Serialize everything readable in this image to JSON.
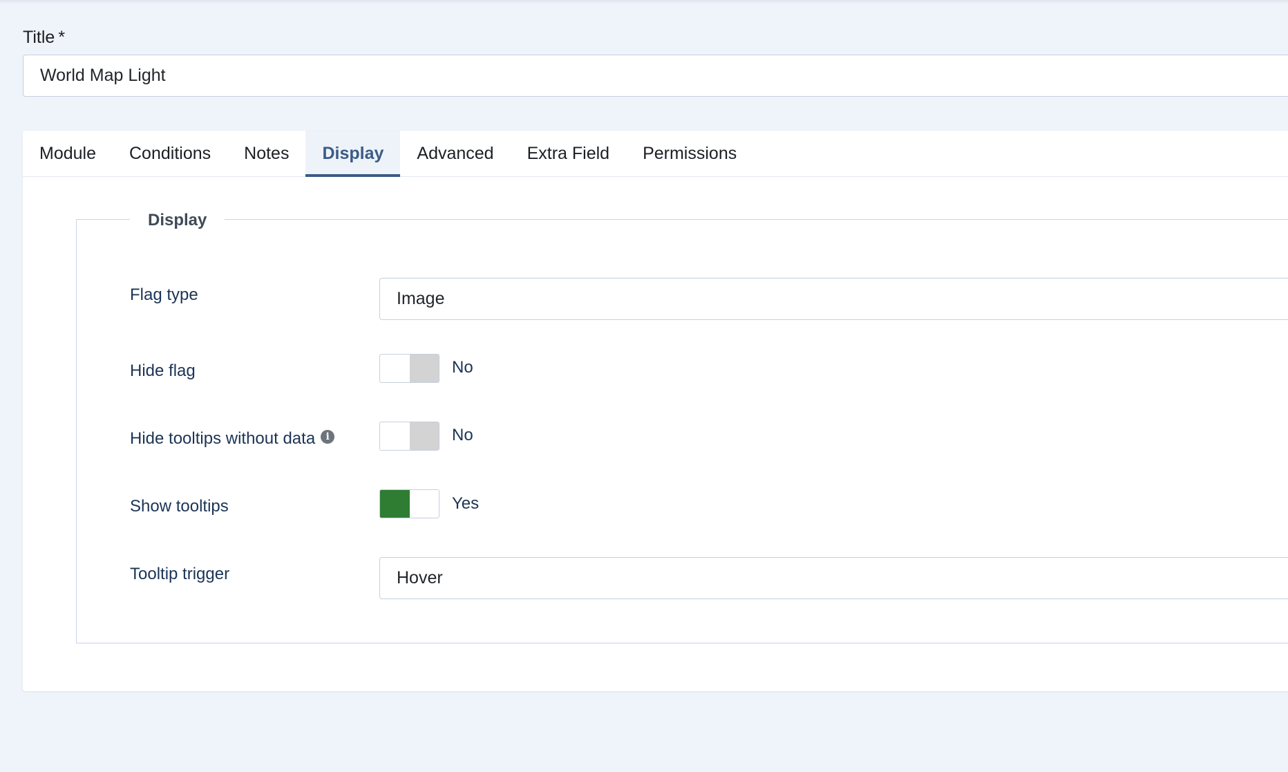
{
  "title_field": {
    "label": "Title",
    "required_mark": "*",
    "value": "World Map Light"
  },
  "tabs": [
    {
      "label": "Module"
    },
    {
      "label": "Conditions"
    },
    {
      "label": "Notes"
    },
    {
      "label": "Display",
      "active": true
    },
    {
      "label": "Advanced"
    },
    {
      "label": "Extra Field"
    },
    {
      "label": "Permissions"
    }
  ],
  "display": {
    "legend": "Display",
    "flag_type": {
      "label": "Flag type",
      "value": "Image"
    },
    "hide_flag": {
      "label": "Hide flag",
      "state": "No"
    },
    "hide_tooltips": {
      "label": "Hide tooltips without data",
      "state": "No"
    },
    "show_tooltips": {
      "label": "Show tooltips",
      "state": "Yes"
    },
    "tooltip_trigger": {
      "label": "Tooltip trigger",
      "value": "Hover"
    }
  },
  "colors": {
    "page_background": "#eff4fb",
    "active_tab": "#3b5b86",
    "switch_on": "#2f7d32",
    "switch_off": "#d3d3d3"
  }
}
